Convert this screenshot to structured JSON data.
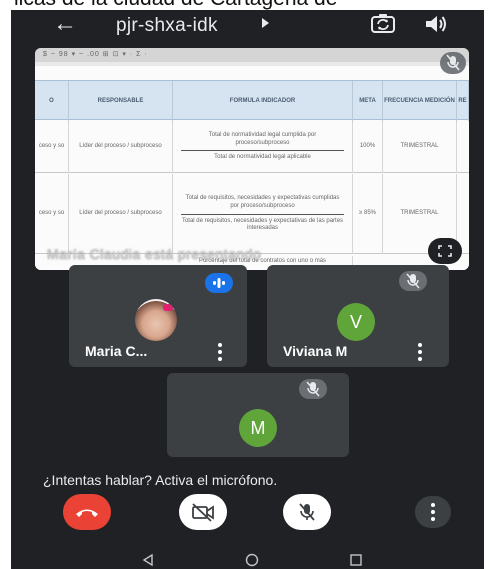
{
  "caption": {
    "text": "licas de la ciudad de Cartagena de"
  },
  "header": {
    "meeting_code": "pjr-shxa-idk",
    "back_icon": "arrow-left-icon",
    "switch_camera_icon": "switch-camera-icon",
    "speaker_icon": "speaker-icon"
  },
  "share": {
    "presenting_label": "María Claudia está presentando",
    "toolbar_text": "$ ~ 98 ▾ ~ .00 ⊞ ⊡ ▾ · Σ ·",
    "sheet": {
      "columns": [
        "O",
        "RESPONSABLE",
        "FORMULA INDICADOR",
        "META",
        "FRECUENCIA MEDICIÓN",
        "RE"
      ],
      "rows": [
        {
          "col0": "ceso y so",
          "responsable": "Líder del proceso / subproceso",
          "formula_num": "Total de normatividad legal cumplida por proceso/subproceso",
          "formula_den": "Total de normatividad legal aplicable",
          "meta": "100%",
          "frecuencia": "TRIMESTRAL"
        },
        {
          "col0": "ceso y so",
          "responsable": "Líder del proceso / subproceso",
          "formula_num": "Total de requisitos, necesidades y expectativas cumplidas por proceso/subproceso",
          "formula_den": "Total de requisitos, necesidades y expectativas de las partes interesadas",
          "meta": "≥ 85%",
          "frecuencia": "TRIMESTRAL"
        }
      ],
      "partial_row": "Porcentaje del total de contratos con uno o más"
    }
  },
  "participants": [
    {
      "name": "Maria C...",
      "avatar": "photo",
      "status": "speaking"
    },
    {
      "name": "Viviana M",
      "avatar_letter": "V",
      "status": "muted"
    },
    {
      "name": "",
      "avatar_letter": "M",
      "status": "muted"
    }
  ],
  "prompt": {
    "text": "¿Intentas hablar? Activa el micrófono."
  },
  "controls": {
    "hangup_icon": "end-call-icon",
    "camera_icon": "camera-off-icon",
    "mic_icon": "mic-off-icon",
    "more_icon": "more-vert-icon"
  },
  "colors": {
    "background": "#202124",
    "tile": "#3c4043",
    "hangup": "#ea4335",
    "avatar_green": "#60a53a",
    "speaking_blue": "#1a73e8"
  }
}
